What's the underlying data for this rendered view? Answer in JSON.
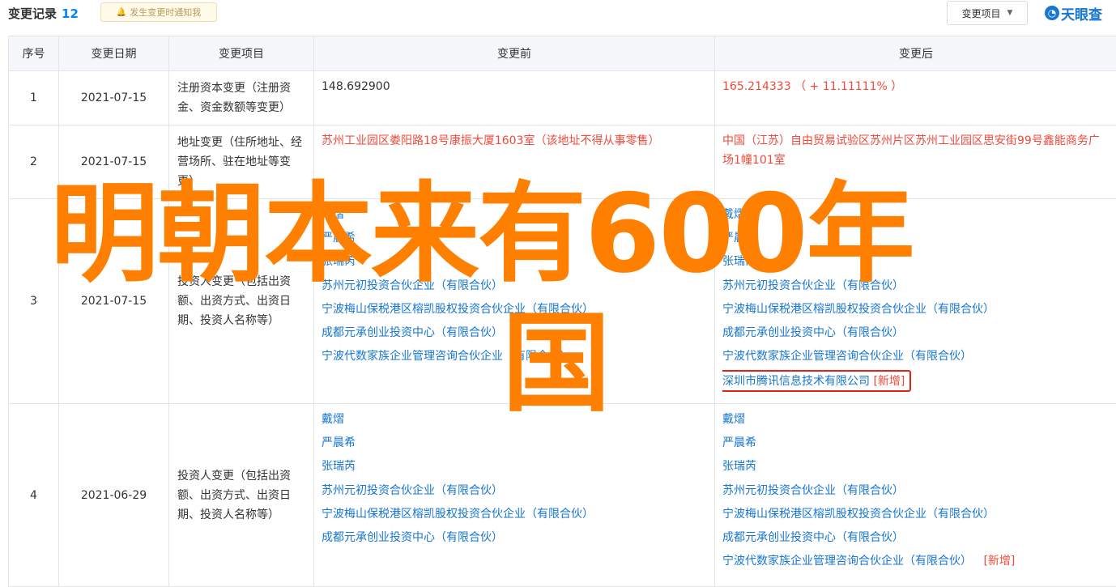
{
  "header": {
    "title": "变更记录",
    "count": "12",
    "notify_label": "发生变更时通知我",
    "dropdown_label": "变更项目",
    "logo_text": "天眼查"
  },
  "columns": [
    "序号",
    "变更日期",
    "变更项目",
    "变更前",
    "变更后"
  ],
  "rows": [
    {
      "no": "1",
      "date": "2021-07-15",
      "item": "注册资本变更（注册资金、资金数额等变更）",
      "before": [
        "148.692900"
      ],
      "after": [
        "165.214333 （ + 11.11111% ）"
      ]
    },
    {
      "no": "2",
      "date": "2021-07-15",
      "item": "地址变更（住所地址、经营场所、驻在地址等变更）",
      "before": [
        "苏州工业园区娄阳路18号康振大厦1603室（该地址不得从事零售）"
      ],
      "after": [
        "中国（江苏）自由贸易试验区苏州片区苏州工业园区思安街99号鑫能商务广场1幢101室"
      ]
    },
    {
      "no": "3",
      "date": "2021-07-15",
      "item": "投资人变更（包括出资额、出资方式、出资日期、投资人名称等）",
      "before": [
        "戴熠",
        "严晨希",
        "张瑞芮",
        "苏州元初投资合伙企业（有限合伙）",
        "宁波梅山保税港区榕凯股权投资合伙企业（有限合伙）",
        "成都元承创业投资中心（有限合伙）",
        "宁波代数家族企业管理咨询合伙企业（有限合伙）"
      ],
      "after": [
        "戴熠",
        "严晨希",
        "张瑞芮",
        "苏州元初投资合伙企业（有限合伙）",
        "宁波梅山保税港区榕凯股权投资合伙企业（有限合伙）",
        "成都元承创业投资中心（有限合伙）",
        "宁波代数家族企业管理咨询合伙企业（有限合伙）"
      ],
      "after_new": "深圳市腾讯信息技术有限公司",
      "new_tag": "[新增]"
    },
    {
      "no": "4",
      "date": "2021-06-29",
      "item": "投资人变更（包括出资额、出资方式、出资日期、投资人名称等）",
      "before": [
        "戴熠",
        "严晨希",
        "张瑞芮",
        "苏州元初投资合伙企业（有限合伙）",
        "宁波梅山保税港区榕凯股权投资合伙企业（有限合伙）",
        "成都元承创业投资中心（有限合伙）"
      ],
      "after": [
        "戴熠",
        "严晨希",
        "张瑞芮",
        "苏州元初投资合伙企业（有限合伙）",
        "宁波梅山保税港区榕凯股权投资合伙企业（有限合伙）",
        "成都元承创业投资中心（有限合伙）",
        "宁波代数家族企业管理咨询合伙企业（有限合伙）"
      ],
      "new_tag": "[新增]"
    }
  ],
  "overlay": {
    "line1": "明朝本来有600年",
    "line2": "国"
  },
  "colors": {
    "accent": "#0084ff",
    "link": "#1676d2",
    "changed": "#f04a3a",
    "overlay": "#ff7f00"
  }
}
